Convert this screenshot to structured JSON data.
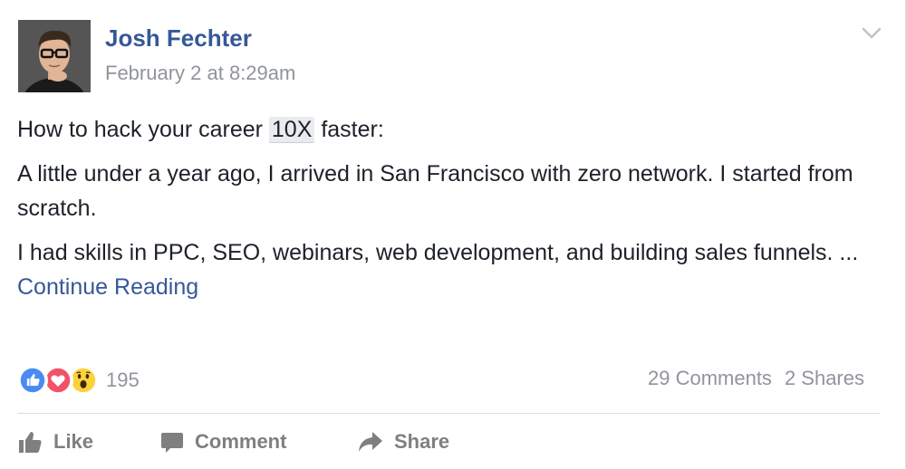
{
  "post": {
    "author": "Josh Fechter",
    "timestamp": "February 2 at 8:29am",
    "body": {
      "line1_before": "How to hack your career ",
      "line1_highlight": "10X",
      "line1_after": " faster:",
      "paragraph2": "A little under a year ago, I arrived in San Francisco with zero network. I started from scratch.",
      "paragraph3": "I had skills in PPC, SEO, webinars, web development, and building sales funnels. ...",
      "continue_link": "Continue Reading"
    },
    "reactions": {
      "icons": [
        "like-icon",
        "love-icon",
        "wow-icon"
      ],
      "count": "195"
    },
    "stats": {
      "comments": "29 Comments",
      "shares": "2 Shares"
    },
    "actions": {
      "like": "Like",
      "comment": "Comment",
      "share": "Share"
    },
    "colors": {
      "link": "#365899",
      "meta": "#90949c",
      "like_blue": "#4a8af4",
      "love_red": "#f25268",
      "wow_yellow": "#fcd13c",
      "action_gray": "#7f7f7f"
    }
  }
}
